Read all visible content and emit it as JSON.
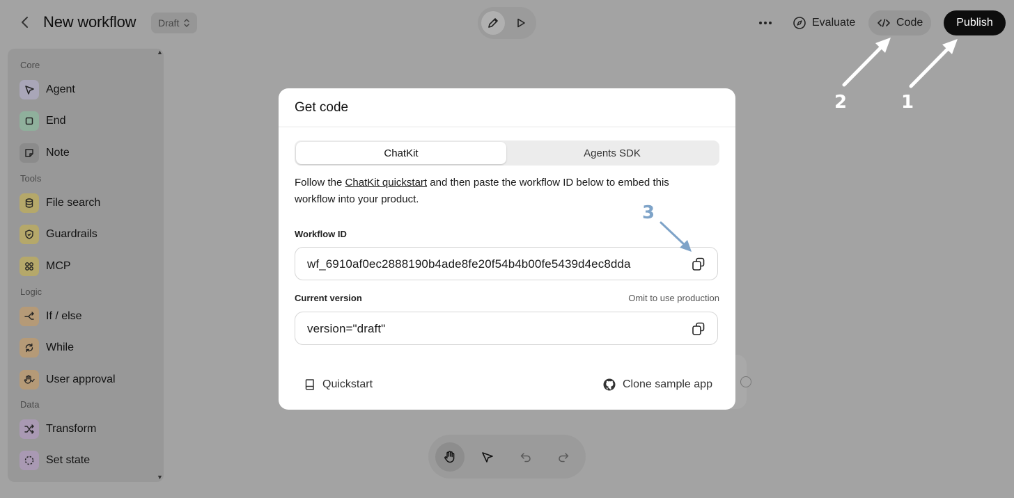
{
  "header": {
    "title": "New workflow",
    "status_badge": "Draft",
    "evaluate_label": "Evaluate",
    "code_label": "Code",
    "publish_label": "Publish"
  },
  "sidebar": {
    "sections": [
      {
        "title": "Core",
        "items": [
          {
            "label": "Agent",
            "icon": "agent-icon",
            "color": "#a9a6b8"
          },
          {
            "label": "End",
            "icon": "stop-icon",
            "color": "#8fb09c"
          },
          {
            "label": "Note",
            "icon": "note-icon",
            "color": "#8b8b8b"
          }
        ]
      },
      {
        "title": "Tools",
        "items": [
          {
            "label": "File search",
            "icon": "database-icon",
            "color": "#b5a86a"
          },
          {
            "label": "Guardrails",
            "icon": "shield-icon",
            "color": "#b5a86a"
          },
          {
            "label": "MCP",
            "icon": "mcp-icon",
            "color": "#b5a86a"
          }
        ]
      },
      {
        "title": "Logic",
        "items": [
          {
            "label": "If / else",
            "icon": "branch-icon",
            "color": "#b59a77"
          },
          {
            "label": "While",
            "icon": "loop-icon",
            "color": "#b59a77"
          },
          {
            "label": "User approval",
            "icon": "hand-approve-icon",
            "color": "#b59a77"
          }
        ]
      },
      {
        "title": "Data",
        "items": [
          {
            "label": "Transform",
            "icon": "shuffle-icon",
            "color": "#a999b3"
          },
          {
            "label": "Set state",
            "icon": "dashed-circle-icon",
            "color": "#a999b3"
          }
        ]
      }
    ]
  },
  "modal": {
    "title": "Get code",
    "tabs": [
      "ChatKit",
      "Agents SDK"
    ],
    "description_before": "Follow the ",
    "description_link": "ChatKit quickstart",
    "description_after": " and then paste the workflow ID below to embed this workflow into your product.",
    "workflow_id_label": "Workflow ID",
    "workflow_id_value": "wf_6910af0ec2888190b4ade8fe20f54b4b00fe5439d4ec8dda",
    "current_version_label": "Current version",
    "current_version_hint": "Omit to use production",
    "current_version_value": "version=\"draft\"",
    "quickstart_label": "Quickstart",
    "clone_label": "Clone sample app"
  },
  "annotations": {
    "step_1": "1",
    "step_2": "2",
    "step_3": "3"
  },
  "colors": {
    "overlay_background": "#a3a3a3",
    "publish_button": "#0d0d0d",
    "annotation_arrow": "#ffffff",
    "annotation_step3": "#7ea3c8"
  }
}
